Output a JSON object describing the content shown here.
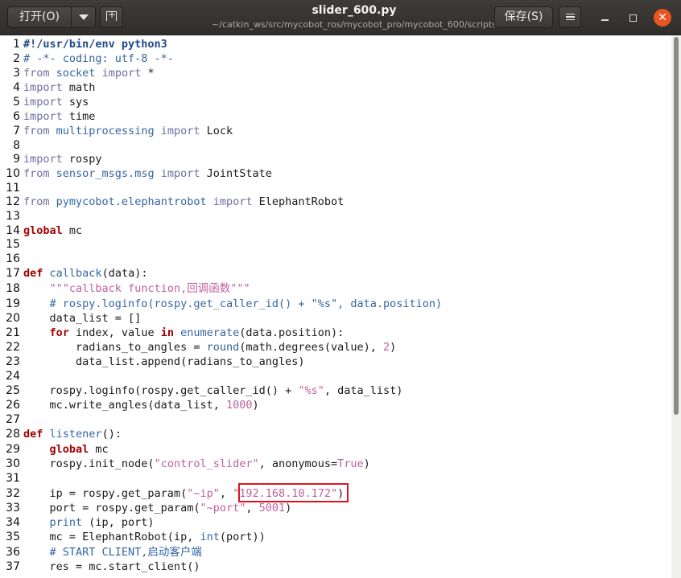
{
  "titlebar": {
    "open_label": "打开(O)",
    "save_label": "保存(S)",
    "file_name": "slider_600.py",
    "file_path": "~/catkin_ws/src/mycobot_ros/mycobot_pro/mycobot_600/scripts",
    "icons": {
      "open_menu": "triangle-down-icon",
      "new_tab": "new-tab-icon",
      "menu": "hamburger-menu-icon",
      "minimize": "minimize-icon",
      "maximize": "maximize-icon",
      "close": "close-icon"
    }
  },
  "colors": {
    "titlebar": "#3d3c38",
    "close_button": "#e95420",
    "keyword": "#a40000",
    "module": "#3465a4",
    "string": "#c060a0",
    "highlight_box": "#e0141e"
  },
  "editor": {
    "language": "python",
    "highlighted_value": "\"192.168.10.172\"",
    "lines": [
      {
        "n": "1",
        "tokens": [
          {
            "t": "#!/usr/bin/env python3",
            "c": "shebang"
          }
        ]
      },
      {
        "n": "2",
        "tokens": [
          {
            "t": "# -*- coding: utf-8 -*-",
            "c": "com"
          }
        ]
      },
      {
        "n": "3",
        "tokens": [
          {
            "t": "from",
            "c": "kw2"
          },
          {
            "t": " ",
            "c": "txt"
          },
          {
            "t": "socket",
            "c": "mod"
          },
          {
            "t": " ",
            "c": "txt"
          },
          {
            "t": "import",
            "c": "kw2"
          },
          {
            "t": " *",
            "c": "txt"
          }
        ]
      },
      {
        "n": "4",
        "tokens": [
          {
            "t": "import",
            "c": "kw2"
          },
          {
            "t": " math",
            "c": "txt"
          }
        ]
      },
      {
        "n": "5",
        "tokens": [
          {
            "t": "import",
            "c": "kw2"
          },
          {
            "t": " sys",
            "c": "txt"
          }
        ]
      },
      {
        "n": "6",
        "tokens": [
          {
            "t": "import",
            "c": "kw2"
          },
          {
            "t": " time",
            "c": "txt"
          }
        ]
      },
      {
        "n": "7",
        "tokens": [
          {
            "t": "from",
            "c": "kw2"
          },
          {
            "t": " ",
            "c": "txt"
          },
          {
            "t": "multiprocessing",
            "c": "mod"
          },
          {
            "t": " ",
            "c": "txt"
          },
          {
            "t": "import",
            "c": "kw2"
          },
          {
            "t": " Lock",
            "c": "txt"
          }
        ]
      },
      {
        "n": "8",
        "tokens": []
      },
      {
        "n": "9",
        "tokens": [
          {
            "t": "import",
            "c": "kw2"
          },
          {
            "t": " rospy",
            "c": "txt"
          }
        ]
      },
      {
        "n": "10",
        "tokens": [
          {
            "t": "from",
            "c": "kw2"
          },
          {
            "t": " ",
            "c": "txt"
          },
          {
            "t": "sensor_msgs.msg",
            "c": "mod"
          },
          {
            "t": " ",
            "c": "txt"
          },
          {
            "t": "import",
            "c": "kw2"
          },
          {
            "t": " JointState",
            "c": "txt"
          }
        ]
      },
      {
        "n": "11",
        "tokens": []
      },
      {
        "n": "12",
        "tokens": [
          {
            "t": "from",
            "c": "kw2"
          },
          {
            "t": " ",
            "c": "txt"
          },
          {
            "t": "pymycobot.elephantrobot",
            "c": "mod"
          },
          {
            "t": " ",
            "c": "txt"
          },
          {
            "t": "import",
            "c": "kw2"
          },
          {
            "t": " ElephantRobot",
            "c": "txt"
          }
        ]
      },
      {
        "n": "13",
        "tokens": []
      },
      {
        "n": "14",
        "tokens": [
          {
            "t": "global",
            "c": "kw"
          },
          {
            "t": " mc",
            "c": "txt"
          }
        ]
      },
      {
        "n": "15",
        "tokens": []
      },
      {
        "n": "16",
        "tokens": []
      },
      {
        "n": "17",
        "tokens": [
          {
            "t": "def",
            "c": "kw"
          },
          {
            "t": " ",
            "c": "txt"
          },
          {
            "t": "callback",
            "c": "mod"
          },
          {
            "t": "(data):",
            "c": "txt"
          }
        ]
      },
      {
        "n": "18",
        "tokens": [
          {
            "t": "    ",
            "c": "txt"
          },
          {
            "t": "\"\"\"callback function,回调函数\"\"\"",
            "c": "str"
          }
        ]
      },
      {
        "n": "19",
        "tokens": [
          {
            "t": "    ",
            "c": "txt"
          },
          {
            "t": "# rospy.loginfo(rospy.get_caller_id() + \"%s\", data.position)",
            "c": "com"
          }
        ]
      },
      {
        "n": "20",
        "tokens": [
          {
            "t": "    data_list = []",
            "c": "txt"
          }
        ]
      },
      {
        "n": "21",
        "tokens": [
          {
            "t": "    ",
            "c": "txt"
          },
          {
            "t": "for",
            "c": "kw"
          },
          {
            "t": " index, value ",
            "c": "txt"
          },
          {
            "t": "in",
            "c": "kw"
          },
          {
            "t": " ",
            "c": "txt"
          },
          {
            "t": "enumerate",
            "c": "bi"
          },
          {
            "t": "(data.position):",
            "c": "txt"
          }
        ]
      },
      {
        "n": "22",
        "tokens": [
          {
            "t": "        radians_to_angles = ",
            "c": "txt"
          },
          {
            "t": "round",
            "c": "bi"
          },
          {
            "t": "(math.degrees(value), ",
            "c": "txt"
          },
          {
            "t": "2",
            "c": "num"
          },
          {
            "t": ")",
            "c": "txt"
          }
        ]
      },
      {
        "n": "23",
        "tokens": [
          {
            "t": "        data_list.append(radians_to_angles)",
            "c": "txt"
          }
        ]
      },
      {
        "n": "24",
        "tokens": []
      },
      {
        "n": "25",
        "tokens": [
          {
            "t": "    rospy.loginfo(rospy.get_caller_id() + ",
            "c": "txt"
          },
          {
            "t": "\"%s\"",
            "c": "str"
          },
          {
            "t": ", data_list)",
            "c": "txt"
          }
        ]
      },
      {
        "n": "26",
        "tokens": [
          {
            "t": "    mc.write_angles(data_list, ",
            "c": "txt"
          },
          {
            "t": "1000",
            "c": "num"
          },
          {
            "t": ")",
            "c": "txt"
          }
        ]
      },
      {
        "n": "27",
        "tokens": []
      },
      {
        "n": "28",
        "tokens": [
          {
            "t": "def",
            "c": "kw"
          },
          {
            "t": " ",
            "c": "txt"
          },
          {
            "t": "listener",
            "c": "mod"
          },
          {
            "t": "():",
            "c": "txt"
          }
        ]
      },
      {
        "n": "29",
        "tokens": [
          {
            "t": "    ",
            "c": "txt"
          },
          {
            "t": "global",
            "c": "kw"
          },
          {
            "t": " mc",
            "c": "txt"
          }
        ]
      },
      {
        "n": "30",
        "tokens": [
          {
            "t": "    rospy.init_node(",
            "c": "txt"
          },
          {
            "t": "\"control_slider\"",
            "c": "str"
          },
          {
            "t": ", anonymous=",
            "c": "txt"
          },
          {
            "t": "True",
            "c": "num"
          },
          {
            "t": ")",
            "c": "txt"
          }
        ]
      },
      {
        "n": "31",
        "tokens": []
      },
      {
        "n": "32",
        "tokens": [
          {
            "t": "    ip = rospy.get_param(",
            "c": "txt"
          },
          {
            "t": "\"~ip\"",
            "c": "str"
          },
          {
            "t": ", ",
            "c": "txt"
          },
          {
            "t": "\"192.168.10.172\"",
            "c": "str"
          },
          {
            "t": ")",
            "c": "txt"
          }
        ]
      },
      {
        "n": "33",
        "tokens": [
          {
            "t": "    port = rospy.get_param(",
            "c": "txt"
          },
          {
            "t": "\"~port\"",
            "c": "str"
          },
          {
            "t": ", ",
            "c": "txt"
          },
          {
            "t": "5001",
            "c": "num"
          },
          {
            "t": ")",
            "c": "txt"
          }
        ]
      },
      {
        "n": "34",
        "tokens": [
          {
            "t": "    ",
            "c": "txt"
          },
          {
            "t": "print",
            "c": "bi"
          },
          {
            "t": " (ip, port)",
            "c": "txt"
          }
        ]
      },
      {
        "n": "35",
        "tokens": [
          {
            "t": "    mc = ElephantRobot(ip, ",
            "c": "txt"
          },
          {
            "t": "int",
            "c": "bi"
          },
          {
            "t": "(port))",
            "c": "txt"
          }
        ]
      },
      {
        "n": "36",
        "tokens": [
          {
            "t": "    ",
            "c": "txt"
          },
          {
            "t": "# START CLIENT,启动客户端",
            "c": "com"
          }
        ]
      },
      {
        "n": "37",
        "tokens": [
          {
            "t": "    res = mc.start_client()",
            "c": "txt"
          }
        ]
      }
    ]
  }
}
